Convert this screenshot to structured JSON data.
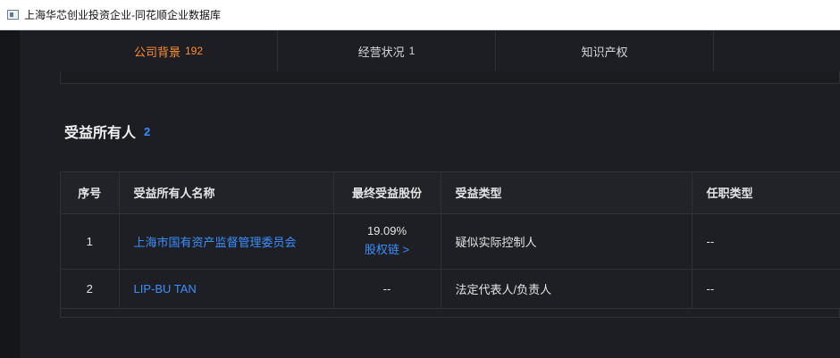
{
  "window": {
    "title": "上海华芯创业投资企业-同花顺企业数据库",
    "icon": "app-window-icon"
  },
  "tabs": [
    {
      "label": "公司背景",
      "count": "192",
      "active": true
    },
    {
      "label": "经营状况",
      "count": "1",
      "active": false
    },
    {
      "label": "知识产权",
      "count": "",
      "active": false
    }
  ],
  "section": {
    "title": "受益所有人",
    "count": "2"
  },
  "table": {
    "headers": [
      "序号",
      "受益所有人名称",
      "最终受益股份",
      "受益类型",
      "任职类型"
    ],
    "rows": [
      {
        "index": "1",
        "name": "上海市国有资产监督管理委员会",
        "share": "19.09%",
        "share_link": "股权链 >",
        "type": "疑似实际控制人",
        "position": "--"
      },
      {
        "index": "2",
        "name": "LIP-BU TAN",
        "share": "--",
        "share_link": "",
        "type": "法定代表人/负责人",
        "position": "--"
      }
    ]
  },
  "colors": {
    "accent_orange": "#ff8f2e",
    "link_blue": "#3c8fff",
    "background": "#1d1e23"
  }
}
